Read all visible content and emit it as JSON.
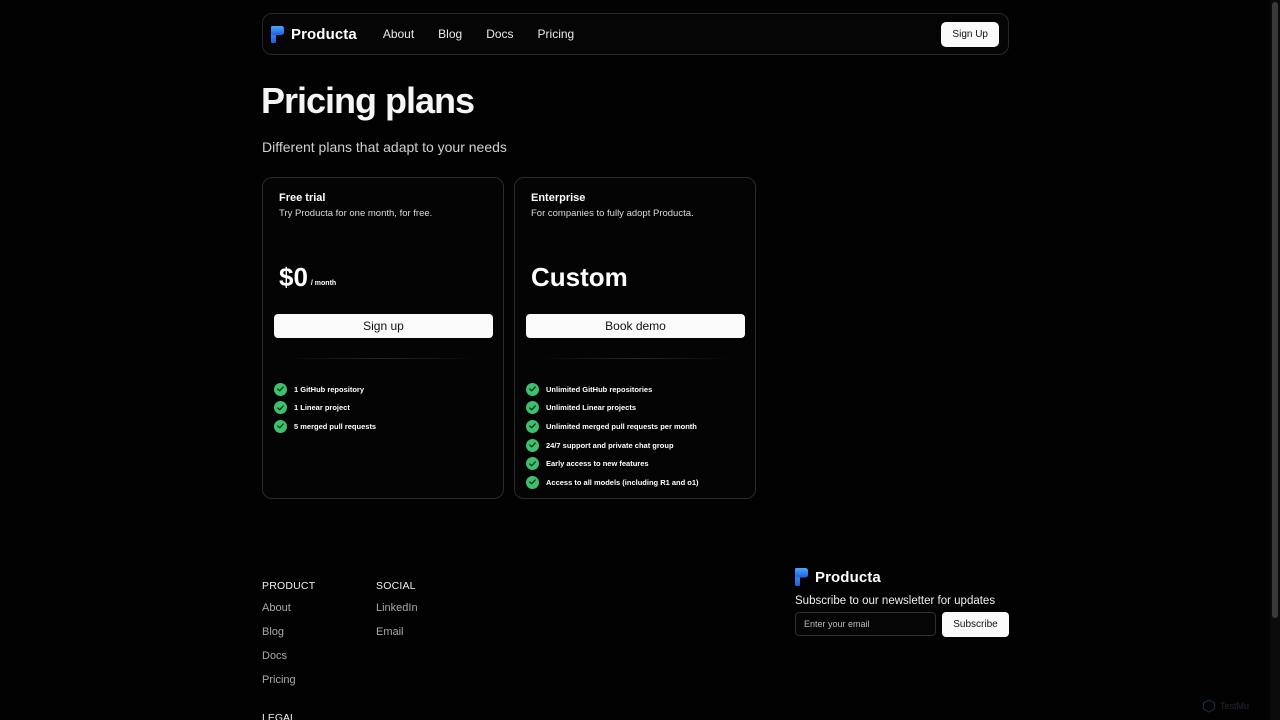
{
  "nav": {
    "brand": "Producta",
    "links": [
      "About",
      "Blog",
      "Docs",
      "Pricing"
    ],
    "signup_label": "Sign Up"
  },
  "header": {
    "title": "Pricing plans",
    "subtitle": "Different plans that adapt to your needs"
  },
  "plans": [
    {
      "name": "Free trial",
      "description": "Try Producta for one month, for free.",
      "price": "$0",
      "price_unit": "/ month",
      "button_label": "Sign up",
      "features": [
        "1 GitHub repository",
        "1 Linear project",
        "5 merged pull requests"
      ]
    },
    {
      "name": "Enterprise",
      "description": "For companies to fully adopt Producta.",
      "price": "Custom",
      "price_unit": "",
      "button_label": "Book demo",
      "features": [
        "Unlimited GitHub repositories",
        "Unlimited Linear projects",
        "Unlimited merged pull requests per month",
        "24/7 support and private chat group",
        "Early access to new features",
        "Access to all models (including R1 and o1)"
      ]
    }
  ],
  "footer": {
    "product": {
      "heading": "PRODUCT",
      "links": [
        "About",
        "Blog",
        "Docs",
        "Pricing"
      ]
    },
    "social": {
      "heading": "SOCIAL",
      "links": [
        "LinkedIn",
        "Email"
      ]
    },
    "legal_heading": "LEGAL",
    "newsletter": {
      "brand": "Producta",
      "title": "Subscribe to our newsletter for updates",
      "placeholder": "Enter your email",
      "button_label": "Subscribe"
    }
  },
  "watermark": {
    "text": "TestMu"
  },
  "colors": {
    "background": "#020202",
    "accent_check": "#3ec16e",
    "logo_blue": "#2f7cf6"
  }
}
